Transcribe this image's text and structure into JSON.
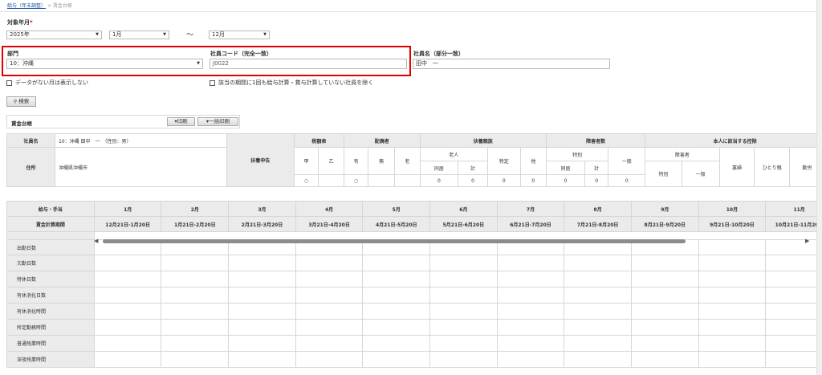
{
  "breadcrumb": {
    "parent": "給与（年末調整）",
    "separator": ">",
    "current": "賃金台帳"
  },
  "filters": {
    "period_label": "対象年月",
    "required_mark": "*",
    "year": "2025年",
    "month_from": "1月",
    "tilde": "〜",
    "month_to": "12月",
    "dept_label": "部門",
    "dept_value": "10：沖縄",
    "emp_code_label": "社員コード（完全一致）",
    "emp_code_value": "J0022",
    "emp_name_label": "社員名（部分一致）",
    "emp_name_value": "田中　一",
    "chk_nodata": "データがない月は表示しない",
    "chk_nocalc": "該当の期間に1回も給与計算・賞与計算していない社員を除く",
    "search_button": "検索"
  },
  "ledger": {
    "title": "賃金台帳",
    "print_button": "印刷",
    "bulk_print_button": "一括印刷",
    "info": {
      "name_label": "社員名",
      "name_value": "10：沖縄 田中　一　（性別：男）",
      "address_label": "住所",
      "address_value": "沖縄県沖縄市",
      "fuyo_label": "扶養申告",
      "zeigaku_label": "税額表",
      "ko": "甲",
      "otsu": "乙",
      "haigu_label": "配偶者",
      "ari": "有",
      "nashi": "無",
      "rou": "老",
      "fuyo_shinzoku_label": "扶養親族",
      "rojin": "老人",
      "doukyo": "同居",
      "kei": "計",
      "tokutei": "特定",
      "ta": "他",
      "shougai_label": "障害者数",
      "tokubetsu": "特別",
      "ippan": "一般",
      "honnin_label": "本人に該当する控除",
      "shougaisha": "障害者",
      "kafu": "寡婦",
      "hitorioya": "ひとり親",
      "kinrou": "勤労",
      "val_ko": "○",
      "val_ari": "○",
      "val_rojin_doukyo": "0",
      "val_rojin_kei": "0",
      "val_tokutei": "0",
      "val_ta": "0",
      "val_sh_doukyo": "0",
      "val_sh_kei": "0",
      "val_sh_ippan": "0"
    },
    "grid": {
      "col_label_1": "給与・手当",
      "col_label_2": "賃金計算期間",
      "months": [
        "1月",
        "2月",
        "3月",
        "4月",
        "5月",
        "6月",
        "7月",
        "8月",
        "9月",
        "10月",
        "11月"
      ],
      "periods": [
        "12月21日-1月20日",
        "1月21日-2月20日",
        "2月21日-3月20日",
        "3月21日-4月20日",
        "4月21日-5月20日",
        "5月21日-6月20日",
        "6月21日-7月20日",
        "7月21日-8月20日",
        "8月21日-9月20日",
        "9月21日-10月20日",
        "10月21日-11月20日"
      ],
      "rows": [
        "出勤日数",
        "欠勤日数",
        "特休日数",
        "有休消化日数",
        "有休消化時間",
        "所定勤務時間",
        "普通残業時間",
        "深夜残業時間"
      ]
    }
  },
  "highlight_color": "#e00000"
}
